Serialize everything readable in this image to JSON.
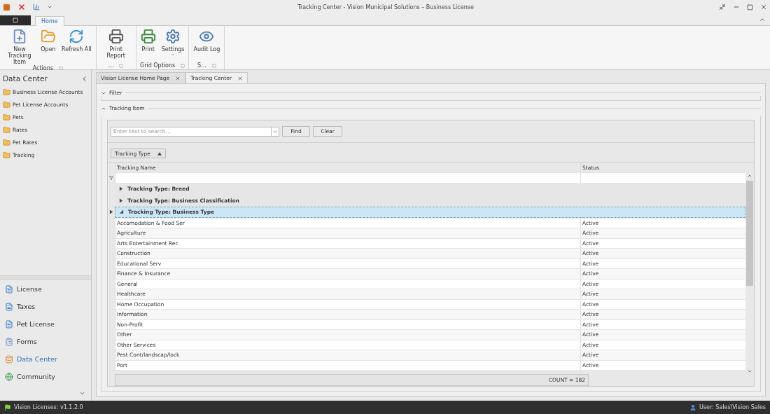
{
  "window": {
    "title": "Tracking Center - Vision Municipal Solutions – Business License"
  },
  "ribbon": {
    "tabs": [
      {
        "label": "Home",
        "selected": true
      }
    ],
    "groups": [
      {
        "label": "Actions",
        "buttons": [
          {
            "label": "New Tracking Item",
            "kind": "button"
          },
          {
            "label": "Open",
            "kind": "button"
          },
          {
            "label": "Refresh All",
            "kind": "button"
          }
        ]
      },
      {
        "label": "...",
        "buttons": [
          {
            "label": "Print Report",
            "kind": "button"
          }
        ]
      },
      {
        "label": "Grid Options",
        "buttons": [
          {
            "label": "Print",
            "kind": "button"
          },
          {
            "label": "Settings",
            "kind": "dropdown"
          }
        ]
      },
      {
        "label": "S...",
        "buttons": [
          {
            "label": "Audit Log",
            "kind": "button"
          }
        ]
      }
    ]
  },
  "sidebar": {
    "title": "Data Center",
    "items": [
      {
        "label": "Business License Accounts"
      },
      {
        "label": "Pet License Accounts"
      },
      {
        "label": "Pets"
      },
      {
        "label": "Rates"
      },
      {
        "label": "Pet Rates"
      },
      {
        "label": "Tracking"
      }
    ],
    "nav": [
      {
        "label": "License",
        "selected": false
      },
      {
        "label": "Taxes",
        "selected": false
      },
      {
        "label": "Pet License",
        "selected": false
      },
      {
        "label": "Forms",
        "selected": false
      },
      {
        "label": "Data Center",
        "selected": true
      },
      {
        "label": "Community",
        "selected": false
      }
    ]
  },
  "doc_tabs": [
    {
      "label": "Vision License Home Page",
      "selected": false
    },
    {
      "label": "Tracking Center",
      "selected": true
    }
  ],
  "filter_group": {
    "label": "Filter",
    "expanded": false
  },
  "tracking_group": {
    "label": "Tracking Item",
    "expanded": true
  },
  "search": {
    "placeholder": "Enter text to search...",
    "buttons": [
      "Find",
      "Clear"
    ]
  },
  "group_by": {
    "label": "Tracking Type"
  },
  "table": {
    "columns": [
      "Tracking Name",
      "Status"
    ],
    "groups": [
      {
        "label": "Tracking Type: Breed",
        "expanded": false,
        "selected": false
      },
      {
        "label": "Tracking Type: Business Classification",
        "expanded": false,
        "selected": false
      },
      {
        "label": "Tracking Type: Business Type",
        "expanded": true,
        "selected": true
      }
    ],
    "rows": [
      [
        "Accomodation & Food Ser",
        "Active"
      ],
      [
        "Agriculture",
        "Active"
      ],
      [
        "Arts Entertainment Rec",
        "Active"
      ],
      [
        "Construction",
        "Active"
      ],
      [
        "Educational Serv",
        "Active"
      ],
      [
        "Finance & Insurance",
        "Active"
      ],
      [
        "General",
        "Active"
      ],
      [
        "Healthcare",
        "Active"
      ],
      [
        "Home Occupation",
        "Active"
      ],
      [
        "Information",
        "Active"
      ],
      [
        "Non-Profit",
        "Active"
      ],
      [
        "Other",
        "Active"
      ],
      [
        "Other Services",
        "Active"
      ],
      [
        "Pest Cont/landscap/lock",
        "Active"
      ],
      [
        "Port",
        "Active"
      ]
    ],
    "footer": "COUNT = 182"
  },
  "status_bar": {
    "version": "Vision Licenses: v1.1.2.0",
    "user": "User: Sales\\Vision Sales"
  }
}
